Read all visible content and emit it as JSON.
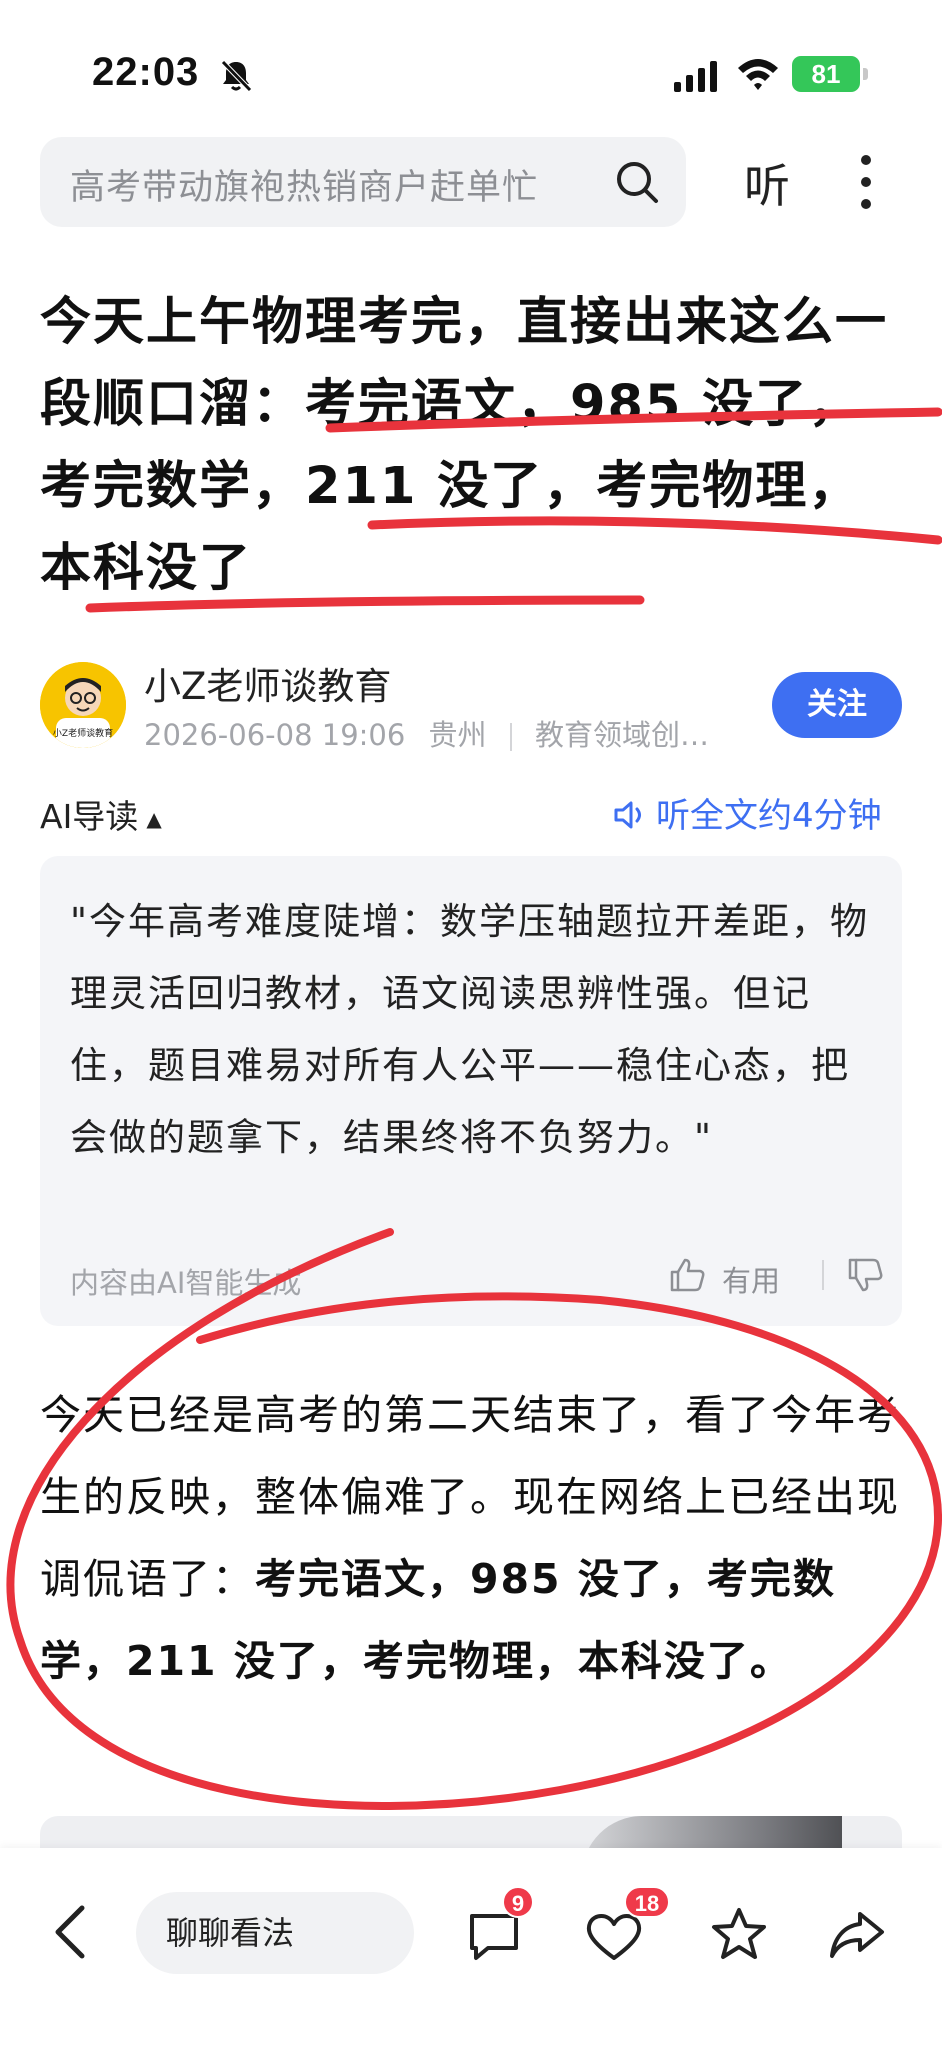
{
  "status_bar": {
    "time": "22:03",
    "battery": "81"
  },
  "header": {
    "search_placeholder": "高考带动旗袍热销商户赶单忙",
    "listen_label": "听"
  },
  "article": {
    "title": "今天上午物理考完，直接出来这么一段顺口溜：考完语文，985 没了，考完数学，211 没了，考完物理，本科没了",
    "author": {
      "name": "小Z老师谈教育",
      "date": "2026-06-08 19:06",
      "location": "贵州",
      "field": "教育领域创…",
      "follow_label": "关注",
      "avatar_text": "小Z老师谈教育"
    },
    "ai_guide": {
      "label": "AI导读",
      "listen_full": "听全文约4分钟",
      "summary": "\"今年高考难度陡增：数学压轴题拉开差距，物理灵活回归教材，语文阅读思辨性强。但记住，题目难易对所有人公平——稳住心态，把会做的题拿下，结果终将不负努力。\"",
      "generated_note": "内容由AI智能生成",
      "useful_label": "有用"
    },
    "body_plain": "今天已经是高考的第二天结束了，看了今年考生的反映，整体偏难了。现在网络上已经出现调侃语了：",
    "body_bold": "考完语文，985 没了，考完数学，211 没了，考完物理，本科没了。"
  },
  "bottom_bar": {
    "comment_placeholder": "聊聊看法",
    "comment_count": "9",
    "like_count": "18"
  },
  "colors": {
    "accent": "#3e6ff2",
    "badge": "#ef3a4a",
    "annotation": "#e8333c",
    "battery": "#34c759"
  }
}
